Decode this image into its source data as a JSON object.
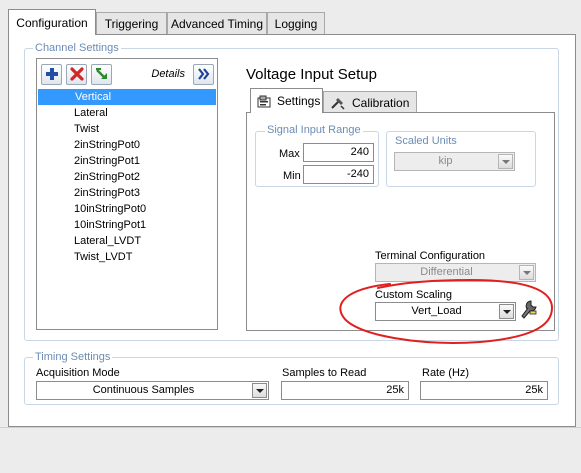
{
  "tabs": [
    {
      "label": "Configuration"
    },
    {
      "label": "Triggering"
    },
    {
      "label": "Advanced Timing"
    },
    {
      "label": "Logging"
    }
  ],
  "channel_settings": {
    "legend": "Channel Settings",
    "details_label": "Details",
    "toolbar_icons": [
      "add-icon",
      "delete-icon",
      "reorder-icon",
      "expand-details-icon"
    ],
    "channels": [
      {
        "label": "Vertical",
        "selected": true
      },
      {
        "label": "Lateral"
      },
      {
        "label": "Twist"
      },
      {
        "label": "2inStringPot0"
      },
      {
        "label": "2inStringPot1"
      },
      {
        "label": "2inStringPot2"
      },
      {
        "label": "2inStringPot3"
      },
      {
        "label": "10inStringPot0"
      },
      {
        "label": "10inStringPot1"
      },
      {
        "label": "Lateral_LVDT"
      },
      {
        "label": "Twist_LVDT"
      }
    ]
  },
  "voltage_setup": {
    "title": "Voltage Input Setup",
    "tabs": [
      {
        "label": "Settings",
        "icon": "settings-icon"
      },
      {
        "label": "Calibration",
        "icon": "calibration-icon"
      }
    ],
    "signal_range": {
      "legend": "Signal Input Range",
      "max_label": "Max",
      "max_value": "240",
      "min_label": "Min",
      "min_value": "-240"
    },
    "scaled_units": {
      "legend": "Scaled Units",
      "value": "kip"
    },
    "terminal_config": {
      "label": "Terminal Configuration",
      "value": "Differential"
    },
    "custom_scaling": {
      "label": "Custom Scaling",
      "value": "Vert_Load",
      "icon": "wrench-icon"
    }
  },
  "timing": {
    "legend": "Timing Settings",
    "acq_mode_label": "Acquisition Mode",
    "acq_mode_value": "Continuous Samples",
    "samples_label": "Samples to Read",
    "samples_value": "25k",
    "rate_label": "Rate (Hz)",
    "rate_value": "25k"
  },
  "colors": {
    "selection": "#3399ff",
    "group_legend": "#6b8cb5",
    "annotation": "#e02020"
  }
}
